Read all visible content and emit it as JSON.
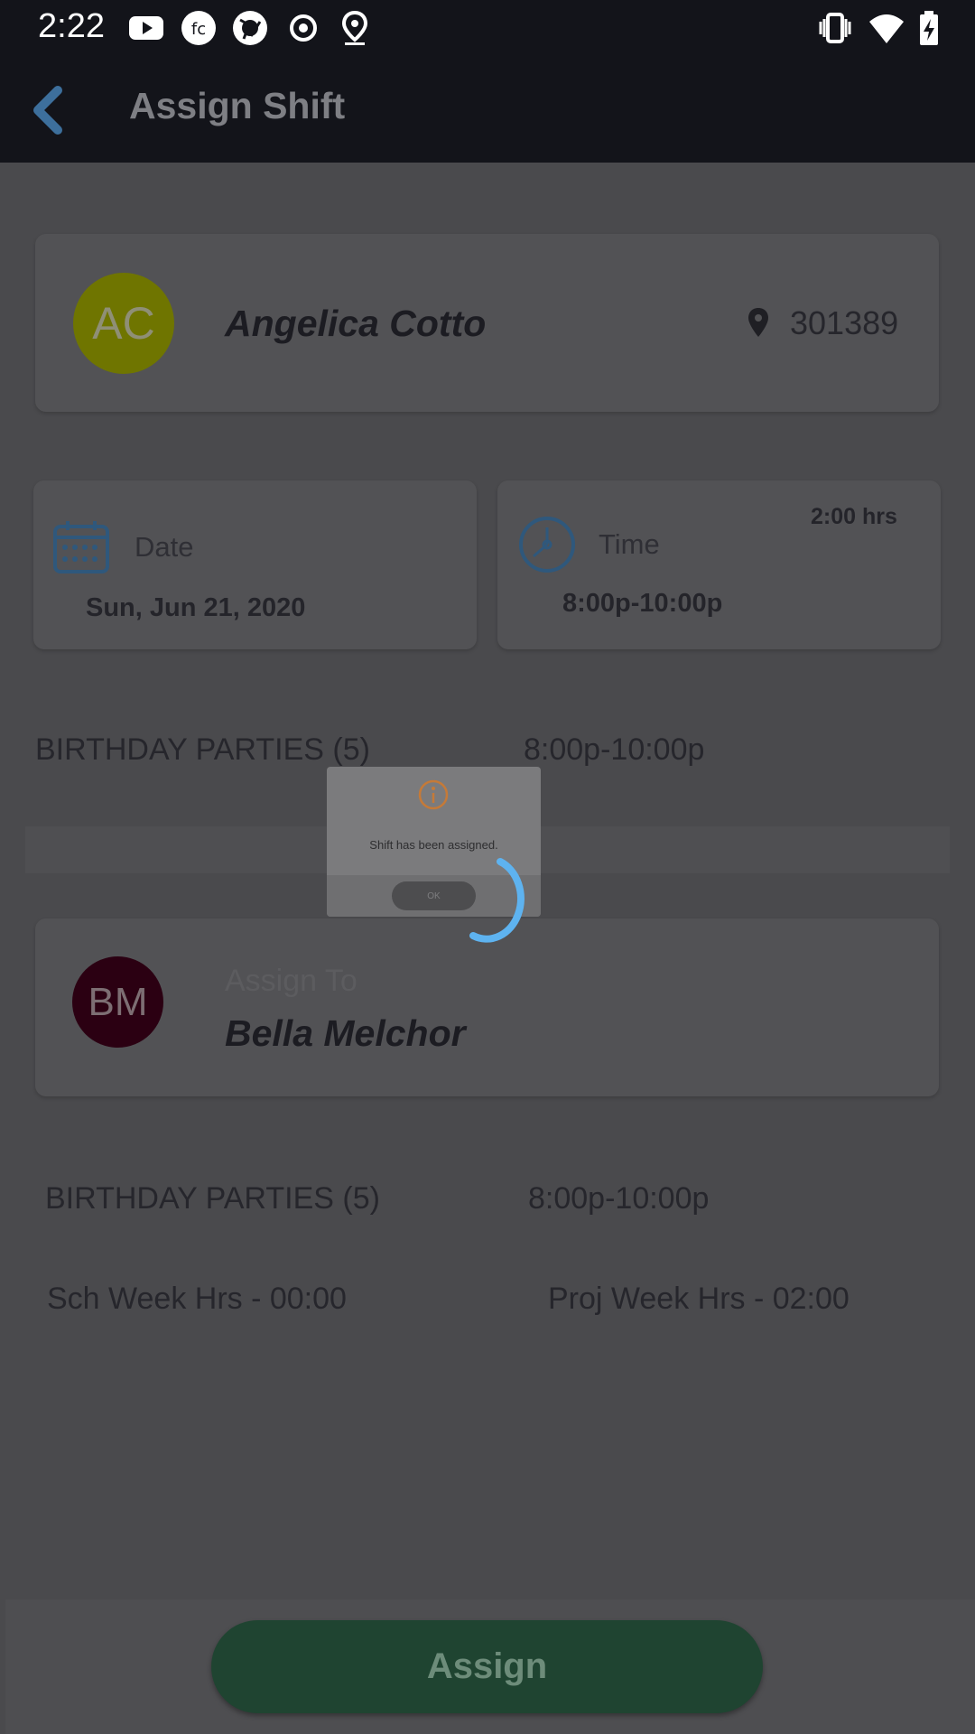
{
  "status_bar": {
    "time": "2:22"
  },
  "app_bar": {
    "title": "Assign Shift"
  },
  "employee_card": {
    "initials": "AC",
    "name": "Angelica Cotto",
    "location_id": "301389",
    "avatar_color": "#9aa600"
  },
  "date_card": {
    "label": "Date",
    "value": "Sun, Jun 21, 2020"
  },
  "time_card": {
    "label": "Time",
    "value": "8:00p-10:00p",
    "duration": "2:00 hrs"
  },
  "shift_row": {
    "name": "BIRTHDAY PARTIES (5)",
    "time": "8:00p-10:00p"
  },
  "dialog": {
    "message": "Shift has been assigned.",
    "ok_label": "OK"
  },
  "assign_card": {
    "initials": "BM",
    "label": "Assign To",
    "name": "Bella Melchor",
    "avatar_color": "#3a0012"
  },
  "assignee_shift_row": {
    "name": "BIRTHDAY PARTIES (5)",
    "time": "8:00p-10:00p"
  },
  "hours": {
    "scheduled": "Sch Week Hrs - 00:00",
    "projected": "Proj Week Hrs - 02:00"
  },
  "footer": {
    "assign_label": "Assign"
  },
  "colors": {
    "accent_blue": "#3d6f9c",
    "spinner": "#5eb3f0",
    "warning": "#c57a38"
  }
}
